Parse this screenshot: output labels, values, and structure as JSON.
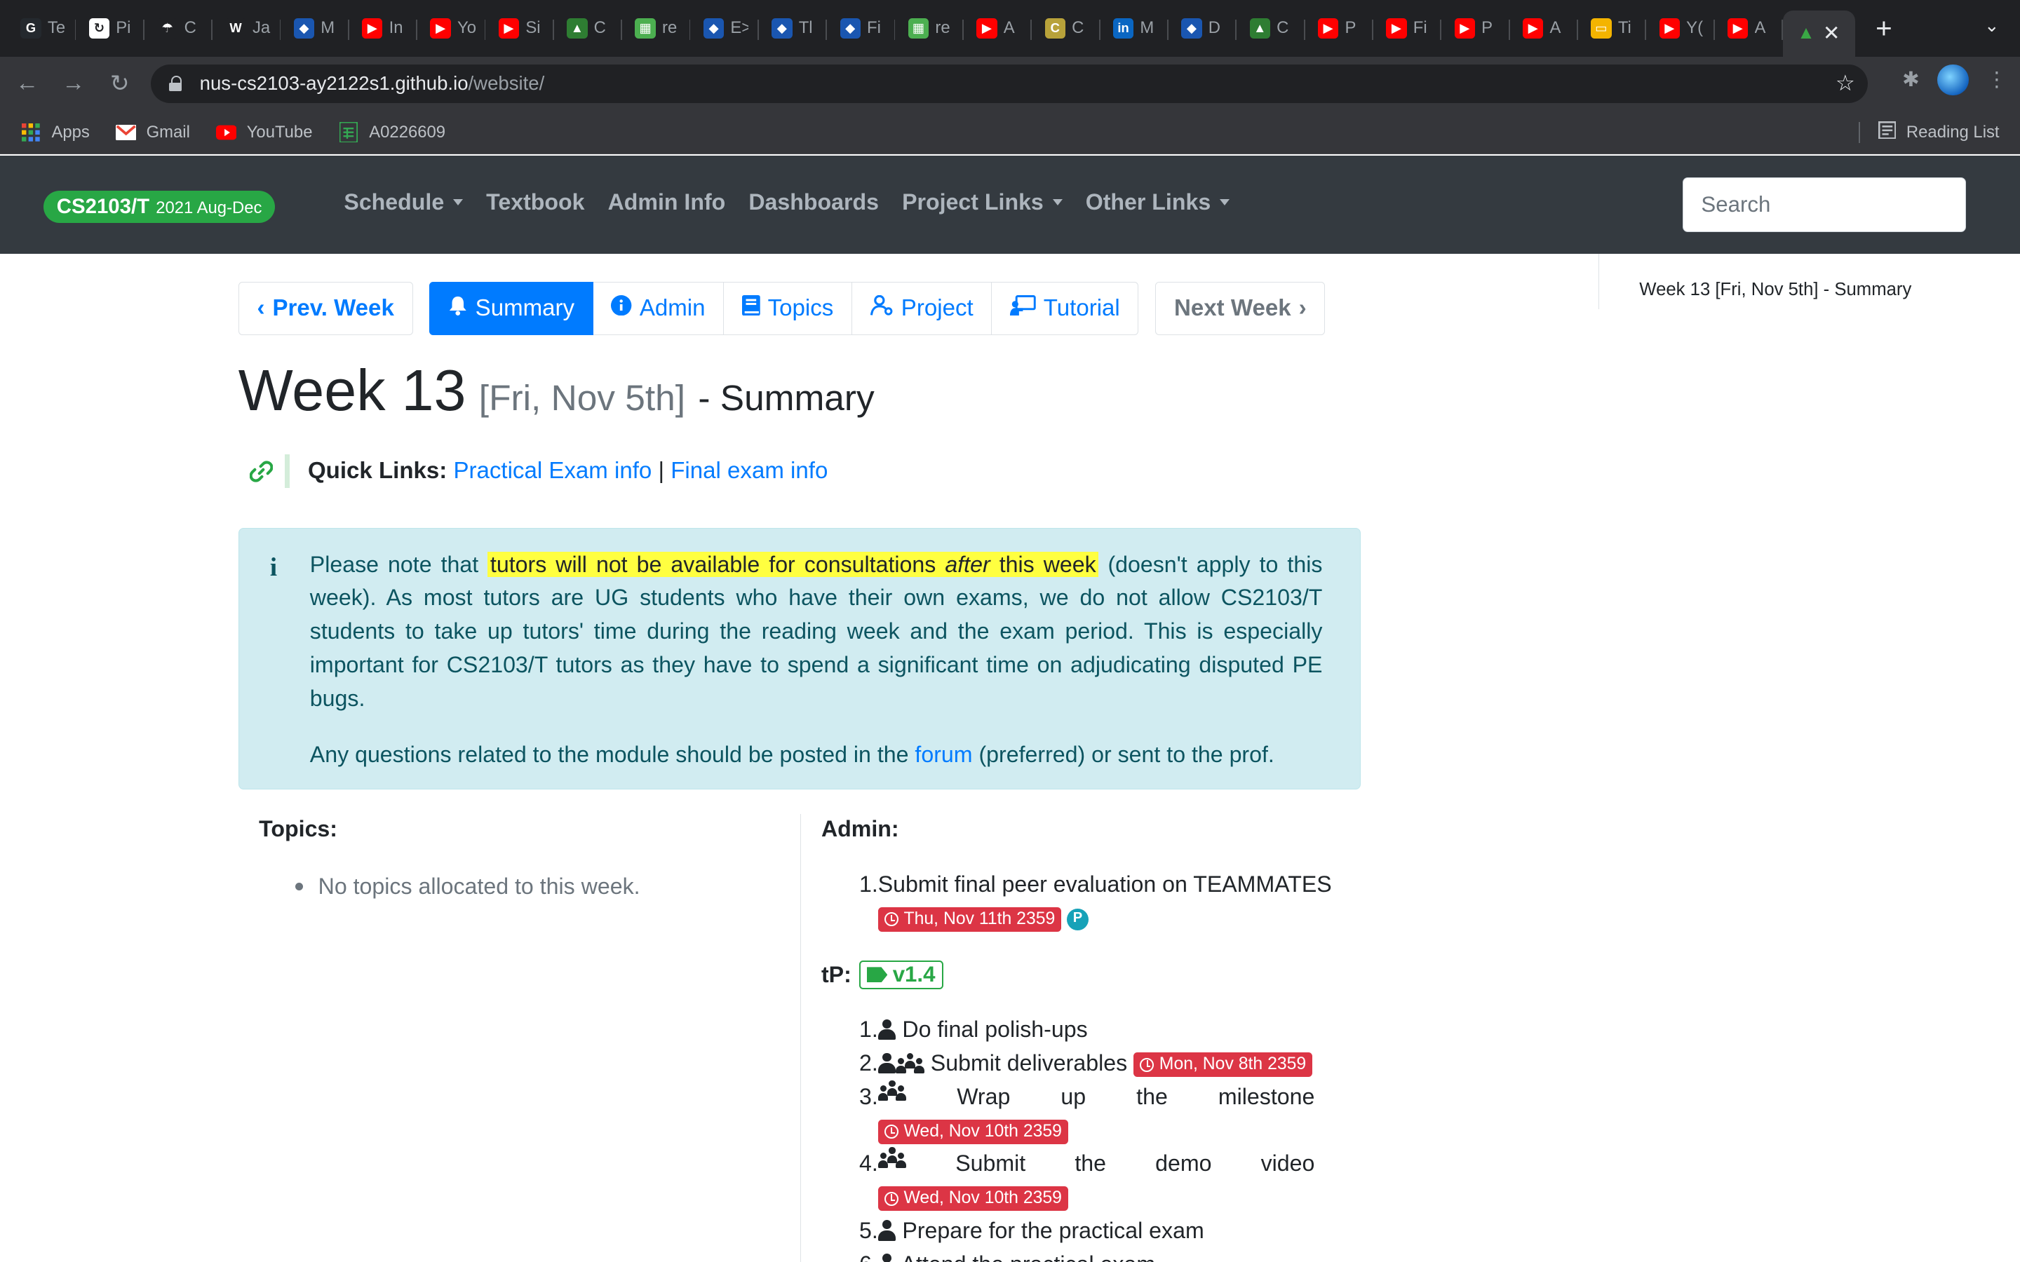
{
  "browser": {
    "tabs": [
      {
        "icon": "github-icon",
        "color": "#24292e",
        "glyph": "G",
        "title": "Te"
      },
      {
        "icon": "refresh-doc-icon",
        "color": "#ffffff",
        "glyph": "↻",
        "title": "Pi"
      },
      {
        "icon": "umbrella-icon",
        "color": "#202124",
        "glyph": "☂",
        "title": "C"
      },
      {
        "icon": "w-icon",
        "color": "#202124",
        "glyph": "W",
        "title": "Ja"
      },
      {
        "icon": "nus-icon",
        "color": "#1a56b0",
        "glyph": "◆",
        "title": "M"
      },
      {
        "icon": "youtube-icon",
        "color": "#ff0000",
        "glyph": "▶",
        "title": "In"
      },
      {
        "icon": "youtube-icon",
        "color": "#ff0000",
        "glyph": "▶",
        "title": "Yo"
      },
      {
        "icon": "youtube-icon",
        "color": "#ff0000",
        "glyph": "▶",
        "title": "Si"
      },
      {
        "icon": "cap-icon",
        "color": "#2e7d32",
        "glyph": "▲",
        "title": "C"
      },
      {
        "icon": "grid-icon",
        "color": "#4caf50",
        "glyph": "▦",
        "title": "re"
      },
      {
        "icon": "nus-icon",
        "color": "#1a56b0",
        "glyph": "◆",
        "title": "E>"
      },
      {
        "icon": "nus-icon",
        "color": "#1a56b0",
        "glyph": "◆",
        "title": "Tl"
      },
      {
        "icon": "nus-icon",
        "color": "#1a56b0",
        "glyph": "◆",
        "title": "Fi"
      },
      {
        "icon": "grid-icon",
        "color": "#4caf50",
        "glyph": "▦",
        "title": "re"
      },
      {
        "icon": "youtube-icon",
        "color": "#ff0000",
        "glyph": "▶",
        "title": "A"
      },
      {
        "icon": "cctv-icon",
        "color": "#b8a23a",
        "glyph": "C",
        "title": "C"
      },
      {
        "icon": "linkedin-icon",
        "color": "#0a66c2",
        "glyph": "in",
        "title": "M"
      },
      {
        "icon": "nus-icon",
        "color": "#1a56b0",
        "glyph": "◆",
        "title": "D"
      },
      {
        "icon": "cap-icon",
        "color": "#2e7d32",
        "glyph": "▲",
        "title": "C"
      },
      {
        "icon": "youtube-icon",
        "color": "#ff0000",
        "glyph": "▶",
        "title": "P"
      },
      {
        "icon": "youtube-icon",
        "color": "#ff0000",
        "glyph": "▶",
        "title": "Fi"
      },
      {
        "icon": "youtube-icon",
        "color": "#ff0000",
        "glyph": "▶",
        "title": "P"
      },
      {
        "icon": "youtube-icon",
        "color": "#ff0000",
        "glyph": "▶",
        "title": "A"
      },
      {
        "icon": "slides-icon",
        "color": "#f4b400",
        "glyph": "▭",
        "title": "Ti"
      },
      {
        "icon": "youtube-icon",
        "color": "#ff0000",
        "glyph": "▶",
        "title": "Y("
      },
      {
        "icon": "youtube-icon",
        "color": "#ff0000",
        "glyph": "▶",
        "title": "A"
      }
    ],
    "url_host": "nus-cs2103-ay2122s1.github.io",
    "url_path": "/website/",
    "bookmarks": {
      "apps": "Apps",
      "gmail": "Gmail",
      "youtube": "YouTube",
      "sheet": "A0226609",
      "reading_list": "Reading List"
    }
  },
  "site": {
    "brand_main": "CS2103/T",
    "brand_sub": "2021 Aug-Dec",
    "nav": [
      "Schedule",
      "Textbook",
      "Admin Info",
      "Dashboards",
      "Project Links",
      "Other Links"
    ],
    "search_placeholder": "Search"
  },
  "toc": {
    "item": "Week 13 [Fri, Nov 5th] - Summary"
  },
  "weeknav": {
    "prev": "Prev. Week",
    "summary": "Summary",
    "admin": "Admin",
    "topics": "Topics",
    "project": "Project",
    "tutorial": "Tutorial",
    "next": "Next Week"
  },
  "heading": {
    "week": "Week 13",
    "date": "[Fri, Nov 5th]",
    "suffix": "- Summary"
  },
  "quicklinks": {
    "label": "Quick Links:",
    "link1": "Practical Exam info",
    "sep": "|",
    "link2": "Final exam info"
  },
  "notice": {
    "p1_pre": "Please note that ",
    "p1_hl_a": "tutors will not be available for consultations ",
    "p1_hl_em": "after",
    "p1_hl_b": " this week",
    "p1_post": " (doesn't apply to this week). As most tutors are UG students who have their own exams, we do not allow CS2103/T students to take up tutors' time during the reading week and the exam period. This is especially important for CS2103/T tutors as they have to spend a significant time on adjudicating disputed PE bugs.",
    "p2_pre": "Any questions related to the module should be posted in the ",
    "p2_link": "forum",
    "p2_post": " (preferred) or sent to the prof."
  },
  "topics": {
    "heading": "Topics:",
    "empty": "No topics allocated to this week."
  },
  "admin": {
    "heading": "Admin:",
    "items": [
      {
        "num": "1.",
        "text": "Submit final peer evaluation on TEAMMATES",
        "deadline": "Thu, Nov 11th 2359",
        "badge": "P"
      }
    ]
  },
  "tp": {
    "label": "tP:",
    "tag": "v1.4",
    "items": [
      {
        "num": "1.",
        "text": "Do final polish-ups"
      },
      {
        "num": "2.",
        "text": "Submit deliverables",
        "deadline": "Mon, Nov 8th 2359"
      },
      {
        "num": "3.",
        "words": [
          "Wrap",
          "up",
          "the",
          "milestone"
        ],
        "deadline": "Wed, Nov 10th 2359"
      },
      {
        "num": "4.",
        "words": [
          "Submit",
          "the",
          "demo",
          "video"
        ],
        "deadline": "Wed, Nov 10th 2359"
      },
      {
        "num": "5.",
        "text": "Prepare for the practical exam"
      },
      {
        "num": "6.",
        "text": "Attend the practical exam"
      }
    ]
  },
  "colors": {
    "brand_green": "#28a745",
    "primary_blue": "#007bff",
    "deadline_red": "#dc3545",
    "navbar_dark": "#343a40",
    "alert_bg": "#d1ecf1",
    "highlight": "#ffff40"
  }
}
